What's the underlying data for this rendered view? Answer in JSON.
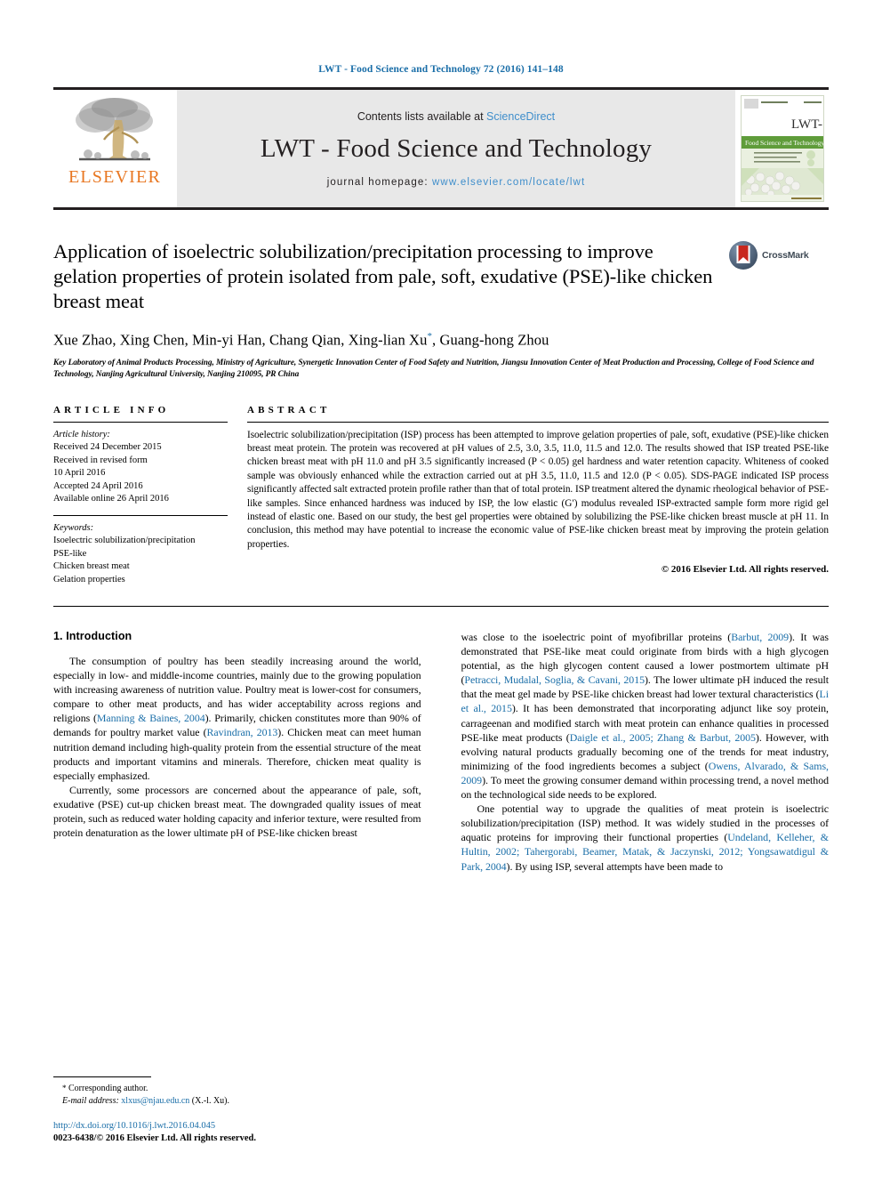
{
  "running_head": "LWT - Food Science and Technology 72 (2016) 141–148",
  "masthead": {
    "publisher_logo_label": "ELSEVIER",
    "contents_prefix": "Contents lists available at",
    "contents_link": "ScienceDirect",
    "journal_name": "LWT - Food Science and Technology",
    "homepage_prefix": "journal homepage:",
    "homepage_url": "www.elsevier.com/locate/lwt",
    "cover_title_top": "LWT -",
    "cover_title_bottom": "Food Science and Technology"
  },
  "crossmark": {
    "label": "CrossMark"
  },
  "article": {
    "title": "Application of isoelectric solubilization/precipitation processing to improve gelation properties of protein isolated from pale, soft, exudative (PSE)-like chicken breast meat",
    "authors": "Xue Zhao, Xing Chen, Min-yi Han, Chang Qian, Xing-lian Xu",
    "authors_tail": ", Guang-hong Zhou",
    "corresponding_marker": "*",
    "affiliation": "Key Laboratory of Animal Products Processing, Ministry of Agriculture, Synergetic Innovation Center of Food Safety and Nutrition, Jiangsu Innovation Center of Meat Production and Processing, College of Food Science and Technology, Nanjing Agricultural University, Nanjing 210095, PR China"
  },
  "article_info": {
    "heading": "ARTICLE INFO",
    "history_label": "Article history:",
    "history": [
      "Received 24 December 2015",
      "Received in revised form",
      "10 April 2016",
      "Accepted 24 April 2016",
      "Available online 26 April 2016"
    ],
    "keywords_label": "Keywords:",
    "keywords": [
      "Isoelectric solubilization/precipitation",
      "PSE-like",
      "Chicken breast meat",
      "Gelation properties"
    ]
  },
  "abstract": {
    "heading": "ABSTRACT",
    "text": "Isoelectric solubilization/precipitation (ISP) process has been attempted to improve gelation properties of pale, soft, exudative (PSE)-like chicken breast meat protein. The protein was recovered at pH values of 2.5, 3.0, 3.5, 11.0, 11.5 and 12.0. The results showed that ISP treated PSE-like chicken breast meat with pH 11.0 and pH 3.5 significantly increased (P < 0.05) gel hardness and water retention capacity. Whiteness of cooked sample was obviously enhanced while the extraction carried out at pH 3.5, 11.0, 11.5 and 12.0 (P < 0.05). SDS-PAGE indicated ISP process significantly affected salt extracted protein profile rather than that of total protein. ISP treatment altered the dynamic rheological behavior of PSE-like samples. Since enhanced hardness was induced by ISP, the low elastic (G′) modulus revealed ISP-extracted sample form more rigid gel instead of elastic one. Based on our study, the best gel properties were obtained by solubilizing the PSE-like chicken breast muscle at pH 11. In conclusion, this method may have potential to increase the economic value of PSE-like chicken breast meat by improving the protein gelation properties.",
    "copyright": "© 2016 Elsevier Ltd. All rights reserved."
  },
  "introduction": {
    "heading": "1.  Introduction",
    "left_paragraphs": [
      {
        "segments": [
          {
            "t": "The consumption of poultry has been steadily increasing around the world, especially in low- and middle-income countries, mainly due to the growing population with increasing awareness of nutrition value. Poultry meat is lower-cost for consumers, compare to other meat products, and has wider acceptability across regions and religions ("
          },
          {
            "t": "Manning & Baines, 2004",
            "link": true
          },
          {
            "t": "). Primarily, chicken constitutes more than 90% of demands for poultry market value ("
          },
          {
            "t": "Ravindran, 2013",
            "link": true
          },
          {
            "t": "). Chicken meat can meet human nutrition demand including high-quality protein from the essential structure of the meat products and important vitamins and minerals. Therefore, chicken meat quality is especially emphasized."
          }
        ]
      },
      {
        "segments": [
          {
            "t": "Currently, some processors are concerned about the appearance of pale, soft, exudative (PSE) cut-up chicken breast meat. The downgraded quality issues of meat protein, such as reduced water holding capacity and inferior texture, were resulted from protein denaturation as the lower ultimate pH of PSE-like chicken breast"
          }
        ]
      }
    ],
    "right_paragraphs": [
      {
        "segments": [
          {
            "t": "was close to the isoelectric point of myofibrillar proteins ("
          },
          {
            "t": "Barbut, 2009",
            "link": true
          },
          {
            "t": "). It was demonstrated that PSE-like meat could originate from birds with a high glycogen potential, as the high glycogen content caused a lower postmortem ultimate pH ("
          },
          {
            "t": "Petracci, Mudalal, Soglia, & Cavani, 2015",
            "link": true
          },
          {
            "t": "). The lower ultimate pH induced the result that the meat gel made by PSE-like chicken breast had lower textural characteristics ("
          },
          {
            "t": "Li et al., 2015",
            "link": true
          },
          {
            "t": "). It has been demonstrated that incorporating adjunct like soy protein, carrageenan and modified starch with meat protein can enhance qualities in processed PSE-like meat products ("
          },
          {
            "t": "Daigle et al., 2005; Zhang & Barbut, 2005",
            "link": true
          },
          {
            "t": "). However, with evolving natural products gradually becoming one of the trends for meat industry, minimizing of the food ingredients becomes a subject ("
          },
          {
            "t": "Owens, Alvarado, & Sams, 2009",
            "link": true
          },
          {
            "t": "). To meet the growing consumer demand within processing trend, a novel method on the technological side needs to be explored."
          }
        ]
      },
      {
        "segments": [
          {
            "t": "One potential way to upgrade the qualities of meat protein is isoelectric solubilization/precipitation (ISP) method. It was widely studied in the processes of aquatic proteins for improving their functional properties ("
          },
          {
            "t": "Undeland, Kelleher, & Hultin, 2002; Tahergorabi, Beamer, Matak, & Jaczynski, 2012; Yongsawatdigul & Park, 2004",
            "link": true
          },
          {
            "t": "). By using ISP, several attempts have been made to"
          }
        ]
      }
    ]
  },
  "footer": {
    "corresponding_marker": "*",
    "corresponding_label": "Corresponding author.",
    "email_label": "E-mail address:",
    "email": "xlxus@njau.edu.cn",
    "email_suffix": "(X.-l. Xu).",
    "doi": "http://dx.doi.org/10.1016/j.lwt.2016.04.045",
    "issn_line": "0023-6438/© 2016 Elsevier Ltd. All rights reserved."
  },
  "colors": {
    "link_blue": "#1a6ea8",
    "elsevier_orange": "#e87722",
    "masthead_grey": "#e8e8e8",
    "cover_green": "#5f9c3a"
  }
}
